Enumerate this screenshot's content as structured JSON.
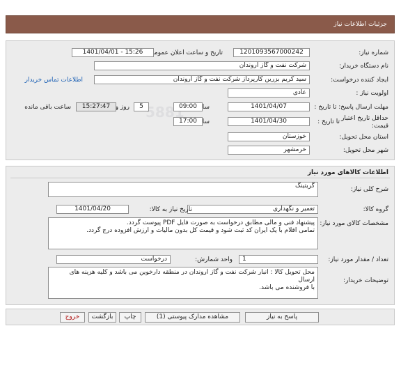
{
  "header": {
    "title": "جزئیات اطلاعات نیاز"
  },
  "form": {
    "need_number_label": "شماره نیاز:",
    "need_number": "1201093567000242",
    "announce_label": "تاریخ و ساعت اعلان عمومی:",
    "announce_value": "1401/04/01 - 15:26",
    "buyer_label": "نام دستگاه خریدار:",
    "buyer_value": "شرکت نفت و گاز اروندان",
    "creator_label": "ایجاد کننده درخواست:",
    "creator_value": "سید کریم بزرین کارپرداز شرکت نفت و گاز اروندان",
    "contact_link": "اطلاعات تماس خریدار",
    "priority_label": "اولویت نیاز :",
    "priority_value": "عادی",
    "deadline_label": "مهلت ارسال پاسخ: تا تاریخ :",
    "deadline_date": "1401/04/07",
    "time_label": "ساعت",
    "deadline_time": "09:00",
    "days_value": "5",
    "days_label": "روز و",
    "remaining_time": "15:27:47",
    "remaining_label": "ساعت باقی مانده",
    "validity_label": "حداقل تاریخ اعتبار قیمت:",
    "validity_until": "تا تاریخ :",
    "validity_date": "1401/04/30",
    "validity_time_label": "ساعت",
    "validity_time": "17:00",
    "province_label": "استان محل تحویل:",
    "province_value": "خوزستان",
    "city_label": "شهر محل تحویل:",
    "city_value": "خرمشهر"
  },
  "goods": {
    "section_title": "اطلاعات کالاهای مورد نیاز",
    "type_label": "شرح کلی نیاز:",
    "type_value": "گریتینگ",
    "group_label": "گروه کالا:",
    "group_value": "تعمیر و نگهداری",
    "need_date_label": "تاریخ نیاز به کالا:",
    "need_date": "1401/04/20",
    "spec_label": "مشخصات کالای مورد نیاز:",
    "spec_lines": [
      "پیشنهاد فنی و مالی مطابق درخواست به صورت فایل PDF پیوست گردد.",
      "تمامی اقلام با یک ایران کد ثبت شود و قیمت کل بدون مالیات و ارزش افزوده درج گردد."
    ],
    "qty_label": "تعداد / مقدار مورد نیاز:",
    "qty_value": "1",
    "unit_label": "واحد شمارش:",
    "unit_value": "درخواست",
    "notes_label": "توضیحات خریدار:",
    "notes_lines": [
      "محل تحویل کالا : انبار شرکت نفت و گاز اروندان در منطقه دارخوین می باشد و کلیه هزینه های ارسال",
      "با فروشنده می باشد."
    ]
  },
  "actions": {
    "reply": "پاسخ به نیاز",
    "attachments": "مشاهده مدارک پیوستی (1)",
    "print": "چاپ",
    "back": "بازگشت",
    "exit": "خروج"
  }
}
